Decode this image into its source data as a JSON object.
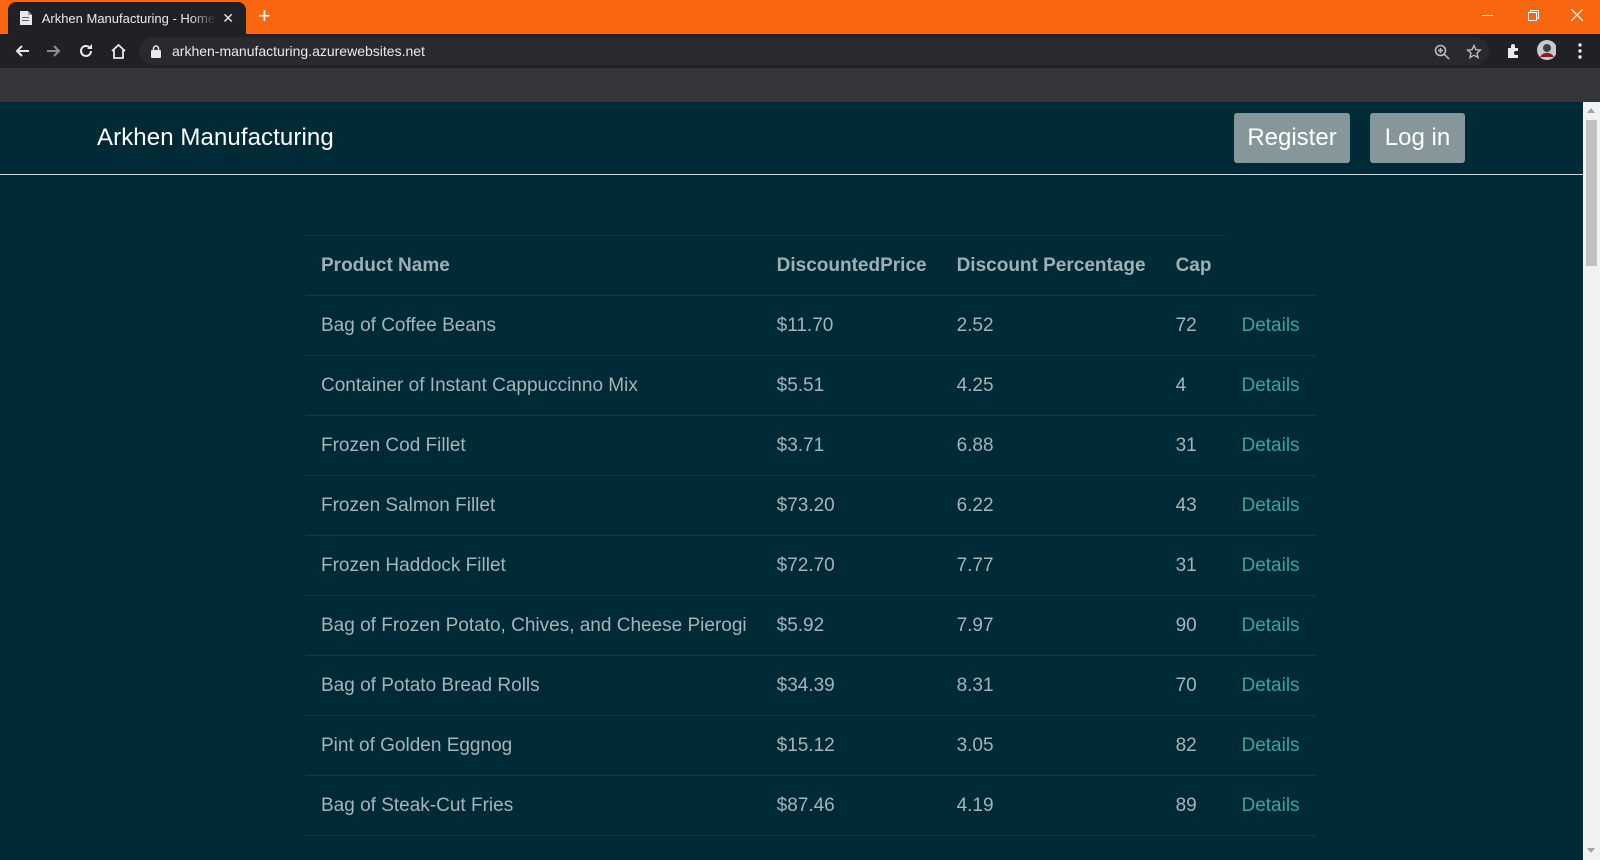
{
  "browser": {
    "tab_title": "Arkhen Manufacturing - Home Page",
    "url": "arkhen-manufacturing.azurewebsites.net",
    "accent": "#f8660f"
  },
  "site": {
    "brand": "Arkhen Manufacturing",
    "register_label": "Register",
    "login_label": "Log in"
  },
  "table": {
    "headers": [
      "Product Name",
      "DiscountedPrice",
      "Discount Percentage",
      "Cap"
    ],
    "details_label": "Details",
    "rows": [
      {
        "name": "Bag of Coffee Beans",
        "price": "$11.70",
        "discount": "2.52",
        "cap": "72"
      },
      {
        "name": "Container of Instant Cappuccinno Mix",
        "price": "$5.51",
        "discount": "4.25",
        "cap": "4"
      },
      {
        "name": "Frozen Cod Fillet",
        "price": "$3.71",
        "discount": "6.88",
        "cap": "31"
      },
      {
        "name": "Frozen Salmon Fillet",
        "price": "$73.20",
        "discount": "6.22",
        "cap": "43"
      },
      {
        "name": "Frozen Haddock Fillet",
        "price": "$72.70",
        "discount": "7.77",
        "cap": "31"
      },
      {
        "name": "Bag of Frozen Potato, Chives, and Cheese Pierogi",
        "price": "$5.92",
        "discount": "7.97",
        "cap": "90"
      },
      {
        "name": "Bag of Potato Bread Rolls",
        "price": "$34.39",
        "discount": "8.31",
        "cap": "70"
      },
      {
        "name": "Pint of Golden Eggnog",
        "price": "$15.12",
        "discount": "3.05",
        "cap": "82"
      },
      {
        "name": "Bag of Steak-Cut Fries",
        "price": "$87.46",
        "discount": "4.19",
        "cap": "89"
      }
    ]
  }
}
